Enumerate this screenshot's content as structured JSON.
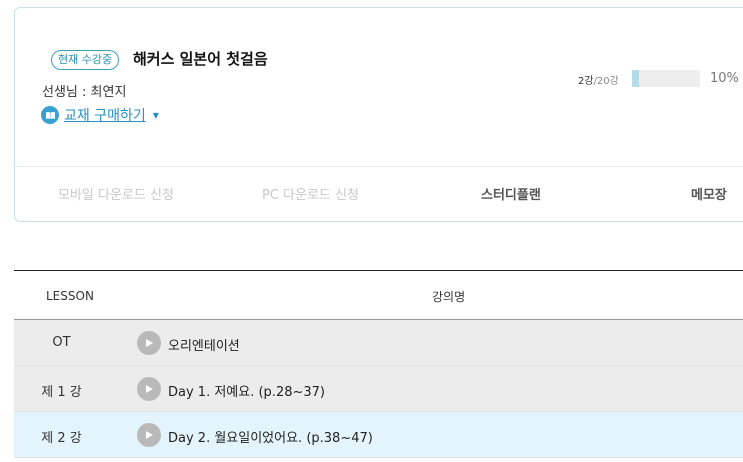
{
  "course": {
    "badge": "현재 수강중",
    "title": "해커스 일본어 첫걸음",
    "teacher": "선생님 : 최연지",
    "book_link": "교재 구매하기",
    "progress": {
      "done": "2강",
      "total": "/20강",
      "percent_label": "10%",
      "fraction": 0.1
    }
  },
  "actions": {
    "mobile": "모바일 다운로드 신청",
    "pc": "PC 다운로드 신청",
    "plan": "스터디플랜",
    "memo": "메모장"
  },
  "table": {
    "headers": {
      "lesson": "LESSON",
      "name": "강의명"
    },
    "rows": [
      {
        "num": "OT",
        "title": "오리엔테이션"
      },
      {
        "num": "제 1 강",
        "title": "Day 1. 저예요. (p.28~37)"
      },
      {
        "num": "제 2 강",
        "title": "Day 2. 월요일이었어요. (p.38~47)"
      }
    ]
  },
  "icons": {
    "book": "book-icon",
    "play": "play-icon",
    "caret": "caret-down-icon"
  },
  "colors": {
    "accent": "#2a90c0",
    "selected_row": "#e3f4fb"
  }
}
